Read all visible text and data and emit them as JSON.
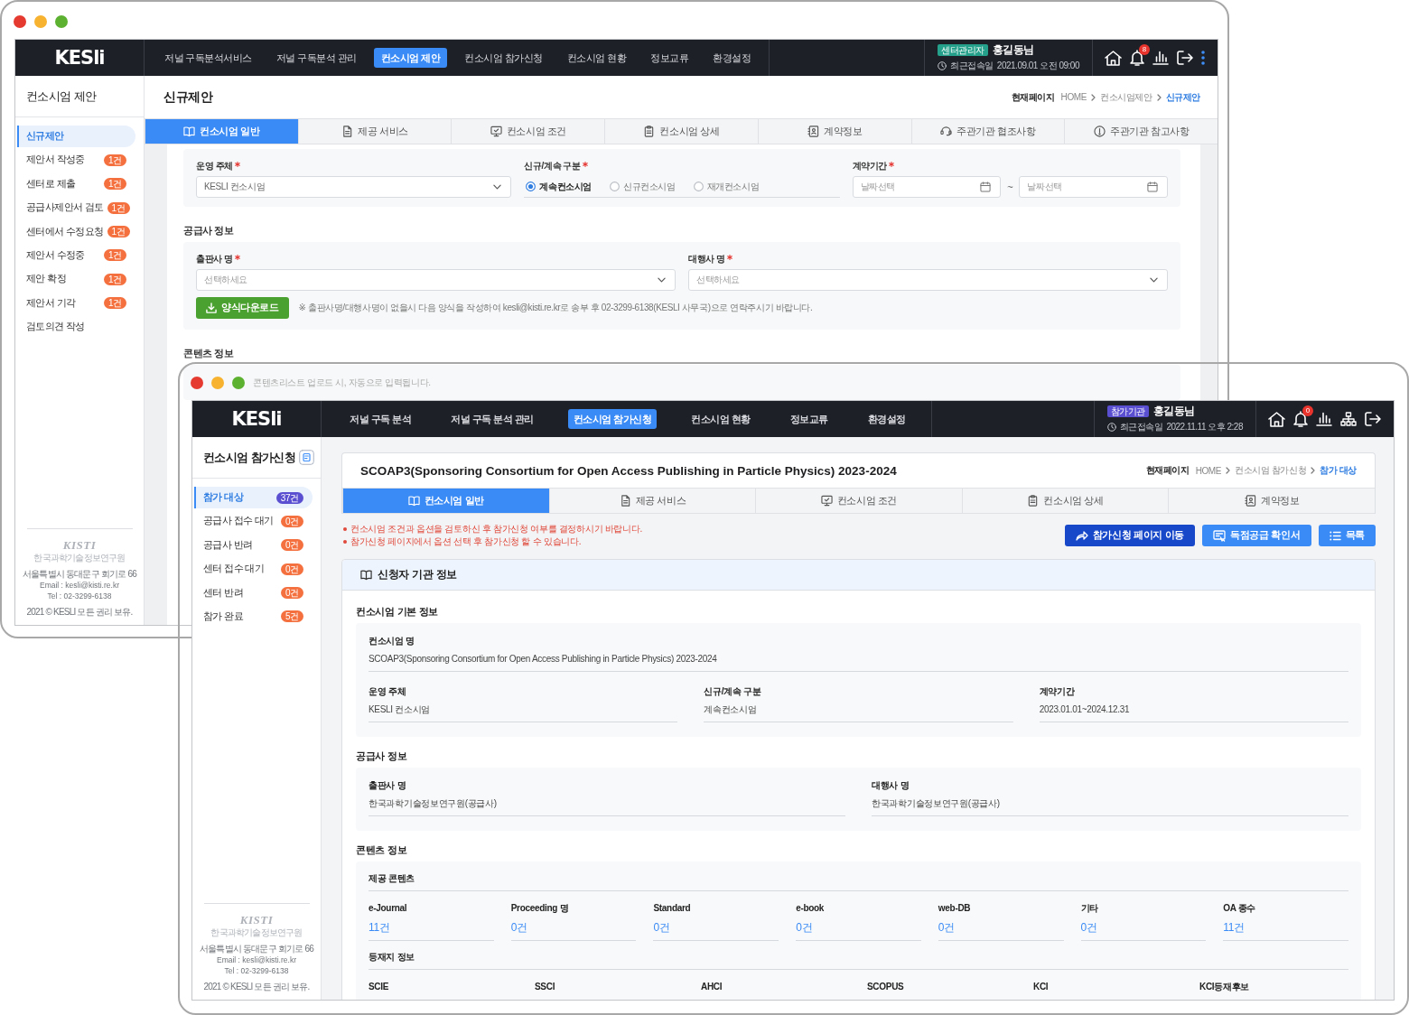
{
  "windows": [
    {
      "kind": "proposal",
      "header": {
        "logo": "KESli",
        "nav": [
          {
            "label": "저널 구독분석서비스",
            "selected": false
          },
          {
            "label": "저널 구독분석 관리",
            "selected": false
          },
          {
            "label": "컨소시엄 제안",
            "selected": true
          },
          {
            "label": "컨소시엄 참가신청",
            "selected": false
          },
          {
            "label": "컨소시엄 현황",
            "selected": false
          },
          {
            "label": "정보교류",
            "selected": false
          },
          {
            "label": "환경설정",
            "selected": false
          }
        ],
        "user": {
          "role": "센터관리자",
          "name": "홍길동님",
          "last_login_label": "최근접속일",
          "last_login": "2021.09.01 오전 09:00"
        },
        "notification_count": "8"
      },
      "sidebar": {
        "title": "컨소시엄 제안",
        "items": [
          {
            "label": "신규제안",
            "selected": true
          },
          {
            "label": "제안서 작성중",
            "count": "1건",
            "selected": false
          },
          {
            "label": "센터로 제출",
            "count": "1건",
            "selected": false
          },
          {
            "label": "공급사제안서 검토",
            "count": "1건",
            "selected": false
          },
          {
            "label": "센터에서 수정요청",
            "count": "1건",
            "selected": false
          },
          {
            "label": "제안서 수정중",
            "count": "1건",
            "selected": false
          },
          {
            "label": "제안 확정",
            "count": "1건",
            "selected": false
          },
          {
            "label": "제안서 기각",
            "count": "1건",
            "selected": false
          },
          {
            "label": "검토의견 작성",
            "selected": false
          }
        ],
        "footer": {
          "logo": "KISTI",
          "logo_subtitle": "한국과학기술정보연구원",
          "address": "서울특별시 동대문구 회기로 66",
          "email": "Email : kesli@kisti.re.kr",
          "tel": "Tel : 02-3299-6138",
          "copyright": "2021 © KESLI 모든 권리 보유."
        }
      },
      "page": {
        "title": "신규제안",
        "breadcrumb": {
          "label": "현재페이지",
          "items": [
            "HOME",
            "컨소시엄제안",
            "신규제안"
          ]
        },
        "tabs": [
          {
            "label": "컨소시엄 일반",
            "selected": true
          },
          {
            "label": "제공 서비스",
            "selected": false
          },
          {
            "label": "컨소시엄 조건",
            "selected": false
          },
          {
            "label": "컨소시엄 상세",
            "selected": false
          },
          {
            "label": "계약정보",
            "selected": false
          },
          {
            "label": "주관기관 협조사항",
            "selected": false
          },
          {
            "label": "주관기관 참고사항",
            "selected": false
          }
        ],
        "form": {
          "fields": [
            {
              "kind": "select",
              "label": "운영 주체",
              "required": true,
              "value": "KESLI 컨소시엄"
            },
            {
              "kind": "radio",
              "label": "신규/계속 구분",
              "required": true,
              "options": [
                {
                  "label": "계속컨소시엄",
                  "selected": true
                },
                {
                  "label": "신규컨소시엄",
                  "selected": false
                },
                {
                  "label": "재개컨소시엄",
                  "selected": false
                }
              ]
            },
            {
              "kind": "date_range",
              "label": "계약기간",
              "required": true,
              "start_placeholder": "날짜선택",
              "separator": "~",
              "end_placeholder": "날짜선택"
            }
          ],
          "sections": [
            {
              "title": "공급사 정보",
              "fields": [
                {
                  "kind": "select",
                  "label": "출판사 명",
                  "required": true,
                  "placeholder": "선택하세요"
                },
                {
                  "kind": "select",
                  "label": "대행사 명",
                  "required": true,
                  "placeholder": "선택하세요"
                }
              ],
              "download_button": "양식다운로드",
              "note": "※ 출판사명/대행사명이 없을시 다음 양식을 작성하여 kesli@kisti.re.kr로 송부 후 02-3299-6138(KESLI 사무국)으로 연락주시기 바랍니다."
            },
            {
              "title": "콘텐츠 정보",
              "note": "콘텐츠리스트 업로드 시, 자동으로 입력됩니다."
            }
          ]
        }
      }
    },
    {
      "kind": "application",
      "header": {
        "logo": "KESli",
        "nav": [
          {
            "label": "저널 구독 분석",
            "selected": false
          },
          {
            "label": "저널 구독 분석 관리",
            "selected": false
          },
          {
            "label": "컨소시엄 참가신청",
            "selected": true
          },
          {
            "label": "컨소시엄 현황",
            "selected": false
          },
          {
            "label": "정보교류",
            "selected": false
          },
          {
            "label": "환경설정",
            "selected": false
          }
        ],
        "user": {
          "role": "참가기관",
          "name": "홍길동님",
          "last_login_label": "최근접속일",
          "last_login": "2022.11.11 오후 2:28"
        },
        "notification_count": "0"
      },
      "sidebar": {
        "title": "컨소시엄 참가신청",
        "items": [
          {
            "label": "참가 대상",
            "count": "37건",
            "selected": true
          },
          {
            "label": "공급사 접수 대기",
            "count": "0건",
            "selected": false
          },
          {
            "label": "공급사 반려",
            "count": "0건",
            "selected": false
          },
          {
            "label": "센터 접수 대기",
            "count": "0건",
            "selected": false
          },
          {
            "label": "센터 반려",
            "count": "0건",
            "selected": false
          },
          {
            "label": "참가 완료",
            "count": "5건",
            "selected": false
          }
        ],
        "footer": {
          "logo": "KISTI",
          "logo_subtitle": "한국과학기술정보연구원",
          "address": "서울특별시 동대문구 회기로 66",
          "email": "Email : kesli@kisti.re.kr",
          "tel": "Tel : 02-3299-6138",
          "copyright": "2021 © KESLI 모든 권리 보유."
        }
      },
      "page": {
        "title": "SCOAP3(Sponsoring Consortium for Open Access Publishing in Particle Physics) 2023-2024",
        "breadcrumb": {
          "label": "현재페이지",
          "items": [
            "HOME",
            "컨소시엄 참가신청",
            "참가 대상"
          ]
        },
        "tabs": [
          {
            "label": "컨소시엄 일반",
            "selected": true
          },
          {
            "label": "제공 서비스",
            "selected": false
          },
          {
            "label": "컨소시엄 조건",
            "selected": false
          },
          {
            "label": "컨소시엄 상세",
            "selected": false
          },
          {
            "label": "계약정보",
            "selected": false
          }
        ],
        "notices": [
          "컨소시엄 조건과 옵션을 검토하신 후 참가신청 여부를 결정하시기 바랍니다.",
          "참가신청 페이지에서 옵션 선택 후 참가신청 할 수 있습니다."
        ],
        "actions": [
          {
            "kind": "primary",
            "label": "참가신청 페이지 이동"
          },
          {
            "kind": "secondary",
            "label": "독점공급 확인서"
          },
          {
            "kind": "secondary",
            "label": "목록"
          }
        ],
        "info_panel": {
          "title": "신청자 기관 정보",
          "sections": [
            {
              "title": "컨소시엄 기본 정보",
              "rows": [
                [
                  {
                    "label": "컨소시엄 명",
                    "value": "SCOAP3(Sponsoring Consortium for Open Access Publishing in Particle Physics) 2023-2024"
                  }
                ],
                [
                  {
                    "label": "운영 주체",
                    "value": "KESLI 컨소시엄"
                  },
                  {
                    "label": "신규/계속 구분",
                    "value": "계속컨소시엄"
                  },
                  {
                    "label": "계약기간",
                    "value": "2023.01.01~2024.12.31"
                  }
                ]
              ]
            },
            {
              "title": "공급사 정보",
              "rows": [
                [
                  {
                    "label": "출판사 명",
                    "value": "한국과학기술정보연구원(공급사)"
                  },
                  {
                    "label": "대행사 명",
                    "value": "한국과학기술정보연구원(공급사)"
                  }
                ]
              ]
            },
            {
              "title": "콘텐츠 정보",
              "groups": [
                {
                  "title": "제공 콘텐츠",
                  "items": [
                    {
                      "label": "e-Journal",
                      "value": "11건"
                    },
                    {
                      "label": "Proceeding 명",
                      "value": "0건"
                    },
                    {
                      "label": "Standard",
                      "value": "0건"
                    },
                    {
                      "label": "e-book",
                      "value": "0건"
                    },
                    {
                      "label": "web-DB",
                      "value": "0건"
                    },
                    {
                      "label": "기타",
                      "value": "0건"
                    },
                    {
                      "label": "OA 종수",
                      "value": "11건"
                    }
                  ]
                },
                {
                  "title": "등재지 정보",
                  "items": [
                    {
                      "label": "SCIE"
                    },
                    {
                      "label": "SSCI"
                    },
                    {
                      "label": "AHCI"
                    },
                    {
                      "label": "SCOPUS"
                    },
                    {
                      "label": "KCI"
                    },
                    {
                      "label": "KCI등재후보"
                    }
                  ]
                }
              ]
            }
          ]
        }
      }
    }
  ]
}
